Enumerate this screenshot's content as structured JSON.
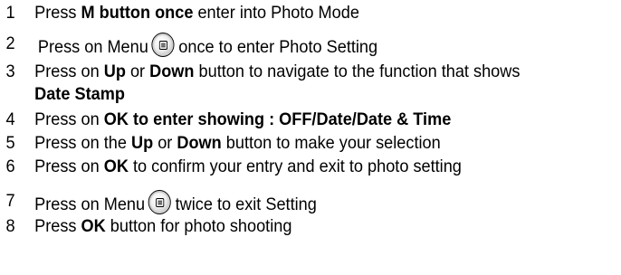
{
  "steps": [
    {
      "num": "1",
      "parts": [
        "Press ",
        "M button once",
        " enter into Photo Mode"
      ]
    },
    {
      "num": "2",
      "parts": [
        "Press on Menu",
        "",
        "once to enter Photo Setting"
      ],
      "icon": "menu-button-icon"
    },
    {
      "num": "3",
      "parts": [
        "Press on ",
        "Up",
        " or ",
        "Down",
        " button to navigate to the function that shows",
        "Date Stamp"
      ]
    },
    {
      "num": "4",
      "parts": [
        "Press on ",
        "OK to enter showing : OFF/Date/Date & Time"
      ]
    },
    {
      "num": "5",
      "parts": [
        "Press on the ",
        "Up",
        " or ",
        "Down",
        " button to make your selection"
      ]
    },
    {
      "num": "6",
      "parts": [
        "Press on ",
        "OK",
        " to confirm your entry and exit to photo setting"
      ]
    },
    {
      "num": "7",
      "parts": [
        "Press on Menu",
        "",
        "twice to exit Setting"
      ],
      "icon": "menu-button-icon"
    },
    {
      "num": "8",
      "parts": [
        "Press ",
        "OK",
        " button for photo shooting"
      ]
    }
  ]
}
